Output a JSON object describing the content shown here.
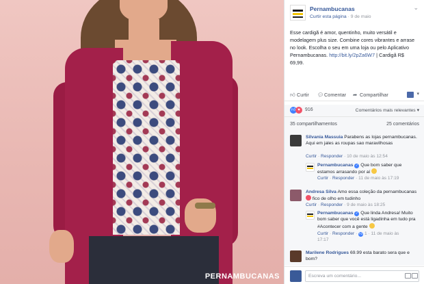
{
  "photo": {
    "watermark": "PERNAMBUCANAS",
    "colors": {
      "background": "#e9b8b3",
      "cardigan": "#a3204a"
    }
  },
  "post": {
    "page_name": "Pernambucanas",
    "like_page": "Curtir esta página",
    "separator": "·",
    "date": "9 de maio",
    "text": "Esse cardigã é amor, quentinho, muito versátil e modelagem plus size. Combine cores vibrantes e arrase no look. Escolha o seu em uma loja ou pelo Aplicativo Pernambucanas. ",
    "link": "http://bit.ly/2pZa6W7",
    "text_after": " | Cardigã R$ 69,99.",
    "menu_icon": "chevron-down-icon"
  },
  "actions": {
    "like": "Curtir",
    "comment": "Comentar",
    "share": "Compartilhar"
  },
  "reactions": {
    "count": "916",
    "sort_label": "Comentários mais relevantes",
    "sort_icon": "▾"
  },
  "stats": {
    "shares": "35 compartilhamentos",
    "comments": "25 comentários"
  },
  "comments": [
    {
      "author": "Silvania Massuia",
      "text": "Parabens as lojas pernambucanas. Aqui em jales as roupas sao maravilhosas",
      "like": "Curtir",
      "reply": "Responder",
      "date": "10 de maio às 12:54"
    },
    {
      "author": "Pernambucanas",
      "text": "Que bom saber que estamos arrasando por aí",
      "like": "Curtir",
      "reply": "Responder",
      "date": "11 de maio às 17:19"
    },
    {
      "author": "Andresa Silva",
      "text_a": "Amo essa coleção da pernambucanas",
      "text_b": "fico de olho em tudinho",
      "like": "Curtir",
      "reply": "Responder",
      "date": "9 de maio às 18:25"
    },
    {
      "author": "Pernambucanas",
      "text": "Que linda Andresa! Muito bom saber que você está ligadinha em tudo pra #Acontecer com a gente",
      "like": "Curtir",
      "reply": "Responder",
      "likes": "1",
      "date_a": "11 de maio às",
      "date_b": "17:17"
    },
    {
      "author": "Marilene Rodrigues",
      "text": "69.99 esta barato sera que e bom?"
    }
  ],
  "write": {
    "placeholder": "Escreva um comentário..."
  }
}
